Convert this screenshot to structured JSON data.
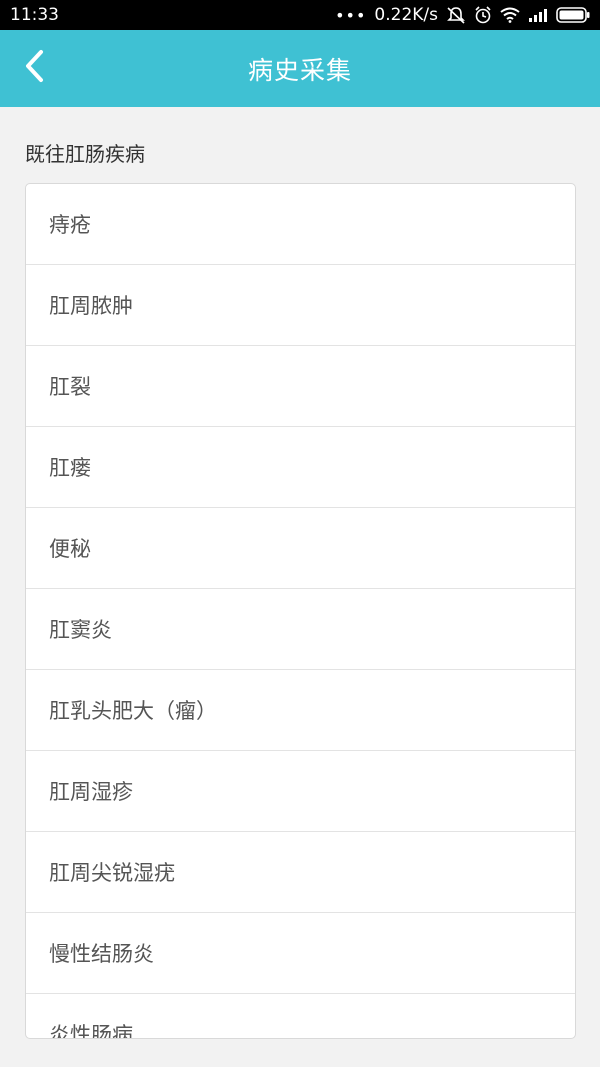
{
  "status_bar": {
    "time": "11:33",
    "network_speed": "0.22K/s",
    "icons": [
      "signal-dots-icon",
      "mute-icon",
      "alarm-icon",
      "wifi-icon",
      "cell-signal-icon",
      "battery-icon"
    ]
  },
  "app_bar": {
    "title": "病史采集",
    "back_icon": "chevron-left-icon",
    "background": "#3fc1d3"
  },
  "section": {
    "title": "既往肛肠疾病"
  },
  "list": {
    "items": [
      "痔疮",
      "肛周脓肿",
      "肛裂",
      "肛瘘",
      "便秘",
      "肛窦炎",
      "肛乳头肥大（瘤）",
      "肛周湿疹",
      "肛周尖锐湿疣",
      "慢性结肠炎",
      "炎性肠病"
    ]
  }
}
